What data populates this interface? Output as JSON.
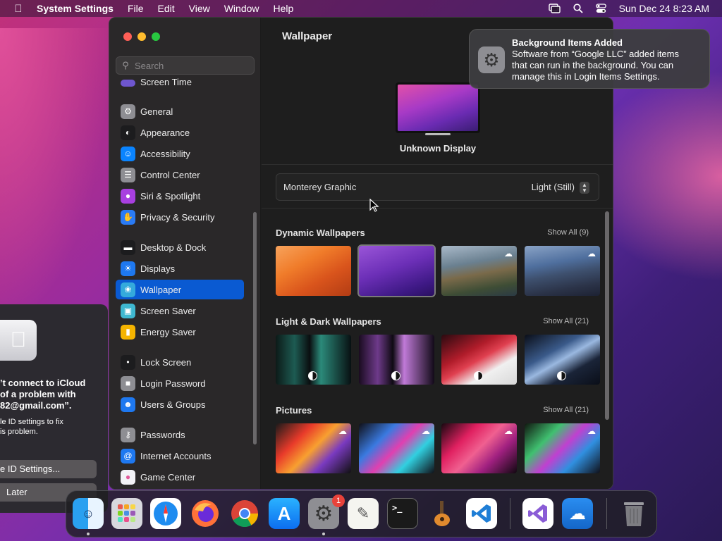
{
  "menubar": {
    "app_name": "System Settings",
    "menus": [
      "File",
      "Edit",
      "View",
      "Window",
      "Help"
    ],
    "clock": "Sun Dec 24  8:23 AM"
  },
  "icloud_dialog": {
    "title": "’t connect to iCloud\nof a problem with\n82@gmail.com”.",
    "body": "le ID settings to fix\nis problem.",
    "settings_button": "e ID Settings...",
    "later_button": "Later"
  },
  "window": {
    "search_placeholder": "Search",
    "sidebar": {
      "partial_item": "Screen Time",
      "items": [
        {
          "label": "General",
          "icon": "gear-icon",
          "color": "#8e8e93"
        },
        {
          "label": "Appearance",
          "icon": "appearance-icon",
          "color": "#1c1c1e"
        },
        {
          "label": "Accessibility",
          "icon": "accessibility-icon",
          "color": "#0a84ff"
        },
        {
          "label": "Control Center",
          "icon": "control-center-icon",
          "color": "#8e8e93"
        },
        {
          "label": "Siri & Spotlight",
          "icon": "siri-icon",
          "color": "#a83fe0"
        },
        {
          "label": "Privacy & Security",
          "icon": "hand-icon",
          "color": "#2a7bf5"
        },
        {
          "label": "Desktop & Dock",
          "icon": "dock-icon",
          "color": "#1c1c1e"
        },
        {
          "label": "Displays",
          "icon": "sun-icon",
          "color": "#1e78f0"
        },
        {
          "label": "Wallpaper",
          "icon": "wallpaper-icon",
          "color": "#34aadc"
        },
        {
          "label": "Screen Saver",
          "icon": "screen-saver-icon",
          "color": "#3fb8d0"
        },
        {
          "label": "Energy Saver",
          "icon": "battery-icon",
          "color": "#f5b400"
        },
        {
          "label": "Lock Screen",
          "icon": "lock-icon",
          "color": "#1c1c1e"
        },
        {
          "label": "Login Password",
          "icon": "padlock-icon",
          "color": "#8e8e93"
        },
        {
          "label": "Users & Groups",
          "icon": "users-icon",
          "color": "#1e78f0"
        },
        {
          "label": "Passwords",
          "icon": "key-icon",
          "color": "#8e8e93"
        },
        {
          "label": "Internet Accounts",
          "icon": "at-icon",
          "color": "#1e78f0"
        },
        {
          "label": "Game Center",
          "icon": "game-center-icon",
          "color": "#f2f2f7"
        }
      ],
      "selected": "Wallpaper"
    },
    "content": {
      "title": "Wallpaper",
      "display_name": "Unknown Display",
      "wallpaper_name": "Monterey Graphic",
      "appearance_mode": "Light (Still)",
      "sections": [
        {
          "title": "Dynamic Wallpapers",
          "show_all": "Show All (9)"
        },
        {
          "title": "Light & Dark Wallpapers",
          "show_all": "Show All (21)"
        },
        {
          "title": "Pictures",
          "show_all": "Show All (21)"
        }
      ]
    }
  },
  "notification": {
    "title": "Background Items Added",
    "body": "Software from “Google LLC” added items\nthat can run in the background. You can\nmanage this in Login Items Settings."
  },
  "dock": {
    "apps": [
      "Finder",
      "Launchpad",
      "Safari",
      "Firefox",
      "Chrome",
      "App Store",
      "System Settings",
      "TextEdit",
      "Terminal",
      "GarageBand",
      "Visual Studio Code",
      "Visual Studio",
      "Weather",
      "Trash"
    ],
    "system_settings_badge": "1"
  }
}
